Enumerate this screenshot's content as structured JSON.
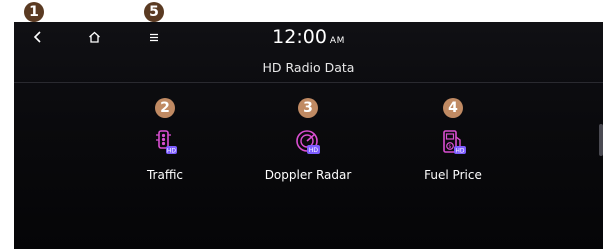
{
  "callouts": {
    "back": "1",
    "traffic": "2",
    "doppler": "3",
    "fuel": "4",
    "menu": "5"
  },
  "header": {
    "time": "12:00",
    "ampm": "AM",
    "title": "HD Radio Data"
  },
  "items": [
    {
      "label": "Traffic",
      "icon": "traffic-light-hd-icon"
    },
    {
      "label": "Doppler Radar",
      "icon": "radar-hd-icon"
    },
    {
      "label": "Fuel Price",
      "icon": "fuel-pump-hd-icon"
    }
  ],
  "colors": {
    "callout_dark": "#5a3a22",
    "callout_light": "#c08a63",
    "icon_pink": "#d94fd1",
    "icon_violet": "#7c5cff"
  }
}
